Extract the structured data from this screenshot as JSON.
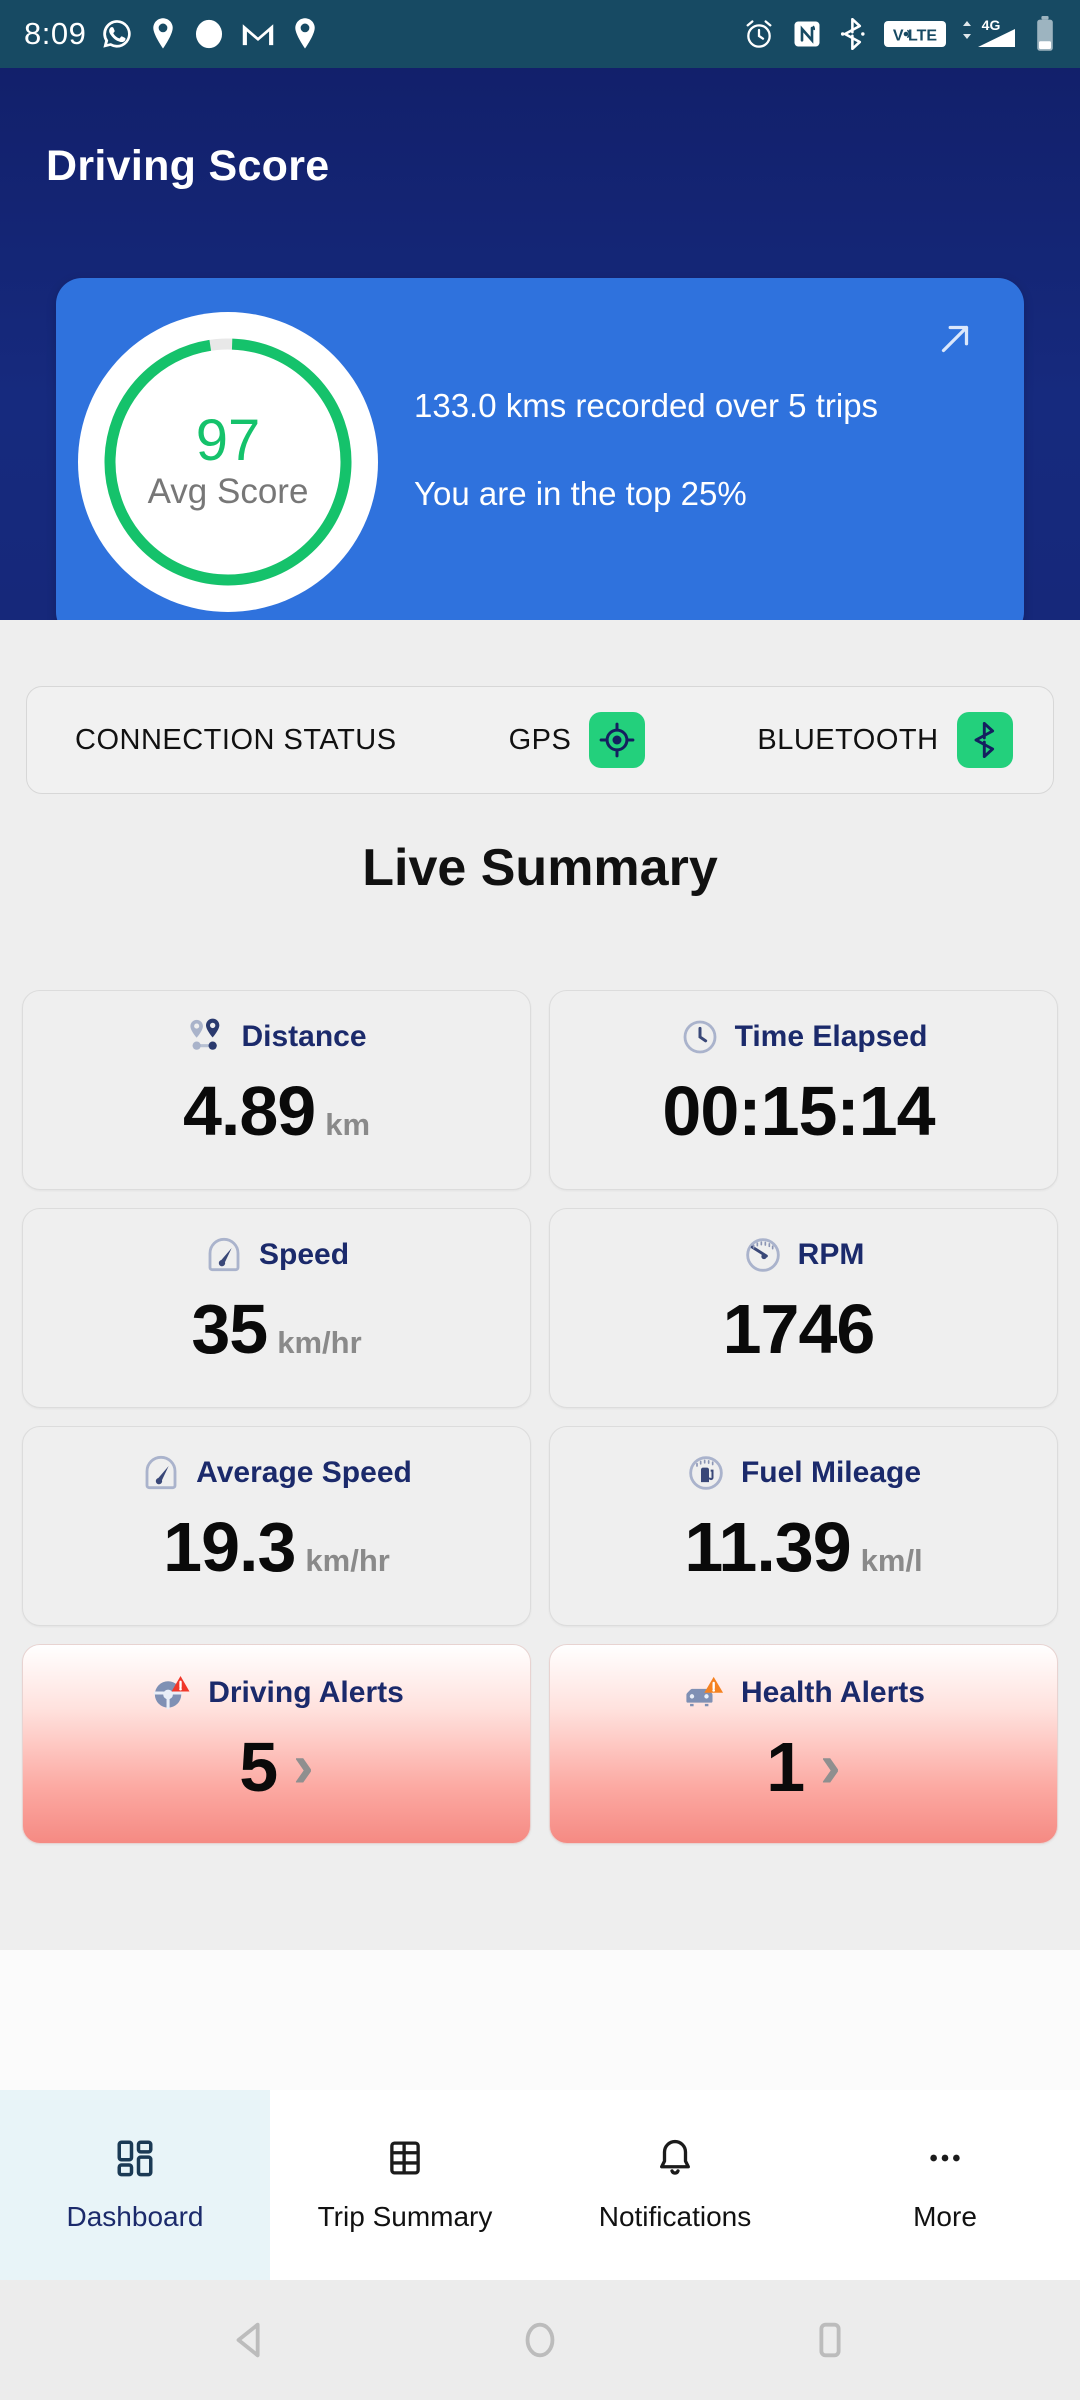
{
  "status_bar": {
    "time": "8:09",
    "left_icons": [
      "whatsapp-icon",
      "location-pin-icon",
      "circle-icon",
      "gmail-icon",
      "location-pin-icon"
    ],
    "right_icons": [
      "alarm-icon",
      "nfc-icon",
      "bluetooth-icon",
      "volte-icon",
      "4g-signal-icon",
      "battery-icon"
    ],
    "volte_label": "V LTE",
    "network_label": "4G",
    "background_color": "#174a63"
  },
  "header": {
    "title": "Driving Score",
    "background_color": "#12206b"
  },
  "score_card": {
    "score": "97",
    "score_label": "Avg Score",
    "score_percent": 97,
    "line1": "133.0 kms recorded over 5 trips",
    "line2": "You are in the top 25%",
    "expand_icon": "arrow-up-right-icon",
    "card_color": "#2f72dd",
    "ring_color": "#15c26b"
  },
  "connection": {
    "title": "CONNECTION STATUS",
    "gps_label": "GPS",
    "gps_icon": "gps-target-icon",
    "bluetooth_label": "BLUETOOTH",
    "bluetooth_icon": "bluetooth-icon",
    "badge_color": "#23d07c"
  },
  "section": {
    "title": "Live Summary"
  },
  "metrics": [
    {
      "label": "Distance",
      "icon": "map-pins-icon",
      "value": "4.89",
      "unit": "km",
      "type": "normal"
    },
    {
      "label": "Time Elapsed",
      "icon": "clock-icon",
      "value": "00:15:14",
      "unit": "",
      "type": "normal"
    },
    {
      "label": "Speed",
      "icon": "speedometer-icon",
      "value": "35",
      "unit": "km/hr",
      "type": "normal"
    },
    {
      "label": "RPM",
      "icon": "rpm-gauge-icon",
      "value": "1746",
      "unit": "",
      "type": "normal"
    },
    {
      "label": "Average Speed",
      "icon": "speedometer-icon",
      "value": "19.3",
      "unit": "km/hr",
      "type": "normal"
    },
    {
      "label": "Fuel Mileage",
      "icon": "fuel-gauge-icon",
      "value": "11.39",
      "unit": "km/l",
      "type": "normal"
    },
    {
      "label": "Driving Alerts",
      "icon": "steering-wheel-alert-icon",
      "value": "5",
      "unit": "",
      "type": "alert",
      "chevron": "›"
    },
    {
      "label": "Health Alerts",
      "icon": "car-alert-icon",
      "value": "1",
      "unit": "",
      "type": "alert",
      "chevron": "›"
    }
  ],
  "bottom_nav": [
    {
      "label": "Dashboard",
      "icon": "dashboard-grid-icon",
      "active": true
    },
    {
      "label": "Trip Summary",
      "icon": "list-table-icon",
      "active": false
    },
    {
      "label": "Notifications",
      "icon": "bell-icon",
      "active": false
    },
    {
      "label": "More",
      "icon": "ellipsis-icon",
      "active": false
    }
  ],
  "android_nav": {
    "back": "back-triangle-icon",
    "home": "home-circle-icon",
    "recents": "recents-square-icon"
  }
}
